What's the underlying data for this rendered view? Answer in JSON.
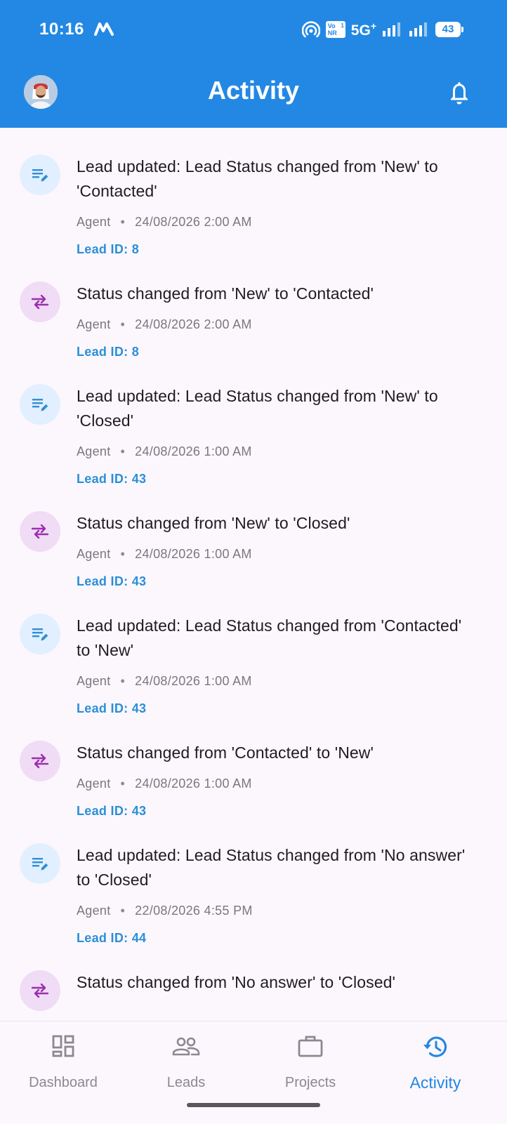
{
  "status_bar": {
    "time": "10:16",
    "carrier_icon": "m-logo-icon",
    "volte_top": "Vo",
    "volte_bottom": "NR",
    "sim_slot": "1",
    "network": "5G",
    "network_suffix": "+",
    "battery_level": "43"
  },
  "header": {
    "title": "Activity",
    "avatar_icon": "profile-avatar",
    "bell_icon": "bell-icon"
  },
  "colors": {
    "primary": "#2388e3",
    "note_icon": "#2f8fd8",
    "note_bg": "#e2efff",
    "swap_icon": "#9b2fb0",
    "swap_bg": "#f0dcf5",
    "lead_id": "#2b8fd6"
  },
  "activities": [
    {
      "icon": "edit-note-icon",
      "title": "Lead updated: Lead Status changed from 'New' to 'Contacted'",
      "actor": "Agent",
      "timestamp": "24/08/2026 2:00 AM",
      "lead_id": "Lead ID: 8"
    },
    {
      "icon": "swap-icon",
      "title": "Status changed from 'New' to 'Contacted'",
      "actor": "Agent",
      "timestamp": "24/08/2026 2:00 AM",
      "lead_id": "Lead ID: 8"
    },
    {
      "icon": "edit-note-icon",
      "title": "Lead updated: Lead Status changed from 'New' to 'Closed'",
      "actor": "Agent",
      "timestamp": "24/08/2026 1:00 AM",
      "lead_id": "Lead ID: 43"
    },
    {
      "icon": "swap-icon",
      "title": "Status changed from 'New' to 'Closed'",
      "actor": "Agent",
      "timestamp": "24/08/2026 1:00 AM",
      "lead_id": "Lead ID: 43"
    },
    {
      "icon": "edit-note-icon",
      "title": "Lead updated: Lead Status changed from 'Contacted' to 'New'",
      "actor": "Agent",
      "timestamp": "24/08/2026 1:00 AM",
      "lead_id": "Lead ID: 43"
    },
    {
      "icon": "swap-icon",
      "title": "Status changed from 'Contacted' to 'New'",
      "actor": "Agent",
      "timestamp": "24/08/2026 1:00 AM",
      "lead_id": "Lead ID: 43"
    },
    {
      "icon": "edit-note-icon",
      "title": "Lead updated: Lead Status changed from 'No answer' to 'Closed'",
      "actor": "Agent",
      "timestamp": "22/08/2026 4:55 PM",
      "lead_id": "Lead ID: 44"
    },
    {
      "icon": "swap-icon",
      "title": "Status changed from 'No answer' to 'Closed'",
      "actor": "",
      "timestamp": "",
      "lead_id": ""
    }
  ],
  "nav": {
    "dashboard": {
      "label": "Dashboard",
      "icon": "dashboard-icon"
    },
    "leads": {
      "label": "Leads",
      "icon": "people-icon"
    },
    "projects": {
      "label": "Projects",
      "icon": "briefcase-icon"
    },
    "activity": {
      "label": "Activity",
      "icon": "history-icon"
    }
  }
}
